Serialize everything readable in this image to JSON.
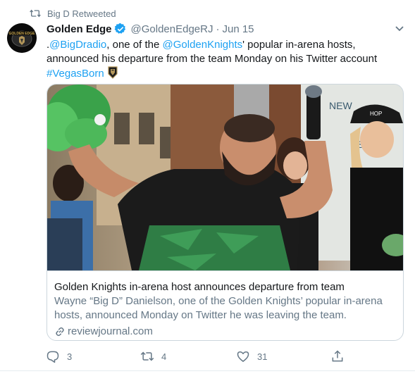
{
  "retweet": {
    "label": "Big D Retweeted",
    "icon": "retweet-icon"
  },
  "author": {
    "name": "Golden Edge",
    "handle": "@GoldenEdgeRJ",
    "separator": "·",
    "date": "Jun 15",
    "verified_icon": "verified-badge-icon",
    "avatar_text": "GOLDEN EDGE"
  },
  "tweet": {
    "prefix": ".",
    "mention_1": "@BigDradio",
    "text_1": ", one of the ",
    "mention_2": "@GoldenKnights",
    "text_2": "' popular in-arena hosts, announced his departure from the team Monday on his Twitter account",
    "hashtag": "#VegasBorn",
    "emoji_icon": "golden-knights-helmet-icon"
  },
  "card": {
    "title": "Golden Knights in-arena host announces departure from team",
    "description": "Wayne “Big D” Danielson, one of the Golden Knights’ popular in-arena hosts, announced Monday on Twitter he was leaving the team.",
    "domain": "reviewjournal.com",
    "cap_text": "HOP"
  },
  "actions": {
    "reply_count": "3",
    "retweet_count": "4",
    "like_count": "31"
  },
  "colors": {
    "accent": "#1da1f2",
    "secondary_text": "#657786",
    "border": "#ccd6dd"
  }
}
